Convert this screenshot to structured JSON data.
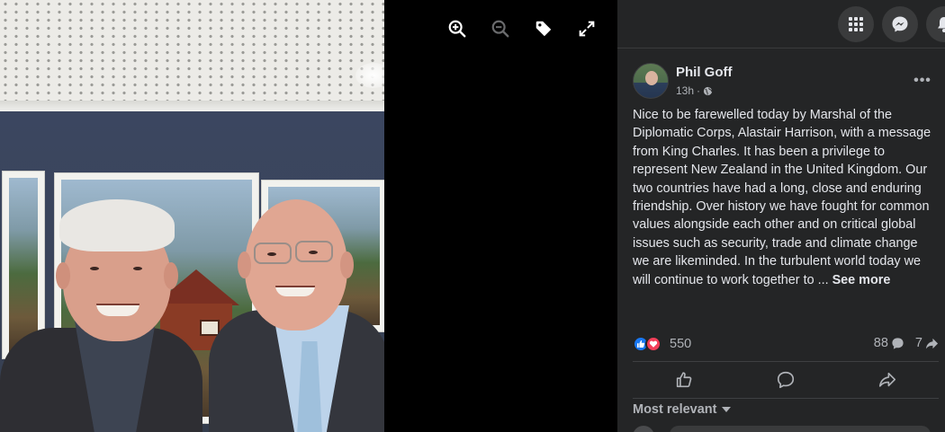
{
  "viewer": {
    "toolbar": [
      {
        "name": "zoom-in-icon",
        "label": "Zoom in"
      },
      {
        "name": "zoom-out-icon",
        "label": "Zoom out"
      },
      {
        "name": "tag-icon",
        "label": "Tag photo"
      },
      {
        "name": "fullscreen-icon",
        "label": "Enter full screen"
      }
    ]
  },
  "topbar": {
    "buttons": [
      {
        "name": "menu-grid-icon"
      },
      {
        "name": "messenger-icon"
      },
      {
        "name": "notifications-bell-icon"
      }
    ]
  },
  "post": {
    "author": "Phil Goff",
    "time": "13h",
    "separator": "·",
    "privacy_icon": "globe-icon",
    "more_label": "•••",
    "text": "Nice to be farewelled today by Marshal of the Diplomatic Corps, Alastair Harrison, with a message from King Charles. It has been a privilege to represent New Zealand in the United Kingdom. Our two countries have had a long, close and enduring friendship. Over history we have fought for common values alongside each other and on critical global issues such as security, trade and climate change we are likeminded. In the turbulent world today we will continue to work together to ... ",
    "see_more": "See more",
    "reactions_count": "550",
    "comments_count": "88",
    "shares_count": "7"
  },
  "actions": [
    {
      "name": "like-icon"
    },
    {
      "name": "comment-icon"
    },
    {
      "name": "share-icon"
    }
  ],
  "comments": {
    "sort_label": "Most relevant"
  },
  "colors": {
    "panel_bg": "#242526",
    "text_primary": "#e4e6eb",
    "text_secondary": "#b0b3b8",
    "like_blue": "#1877f2",
    "love_red": "#f33e58"
  }
}
